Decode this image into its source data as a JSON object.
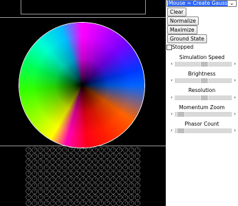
{
  "controls": {
    "mouse_mode": "Mouse = Create Gaussian",
    "mouse_chevron_icon": "chevron-down-icon",
    "buttons": [
      "Clear",
      "Normalize",
      "Maximize",
      "Ground State"
    ],
    "stopped_label": "Stopped",
    "stopped_checked": false
  },
  "sliders": [
    {
      "label": "Simulation Speed",
      "value": 0.5
    },
    {
      "label": "Brightness",
      "value": 0.5
    },
    {
      "label": "Resolution",
      "value": 0.5
    },
    {
      "label": "Momentum Zoom",
      "value": 0.1
    },
    {
      "label": "Phasor Count",
      "value": 0.1
    }
  ],
  "icons": {
    "left": "‹",
    "right": "›",
    "chevron": "⌄"
  }
}
